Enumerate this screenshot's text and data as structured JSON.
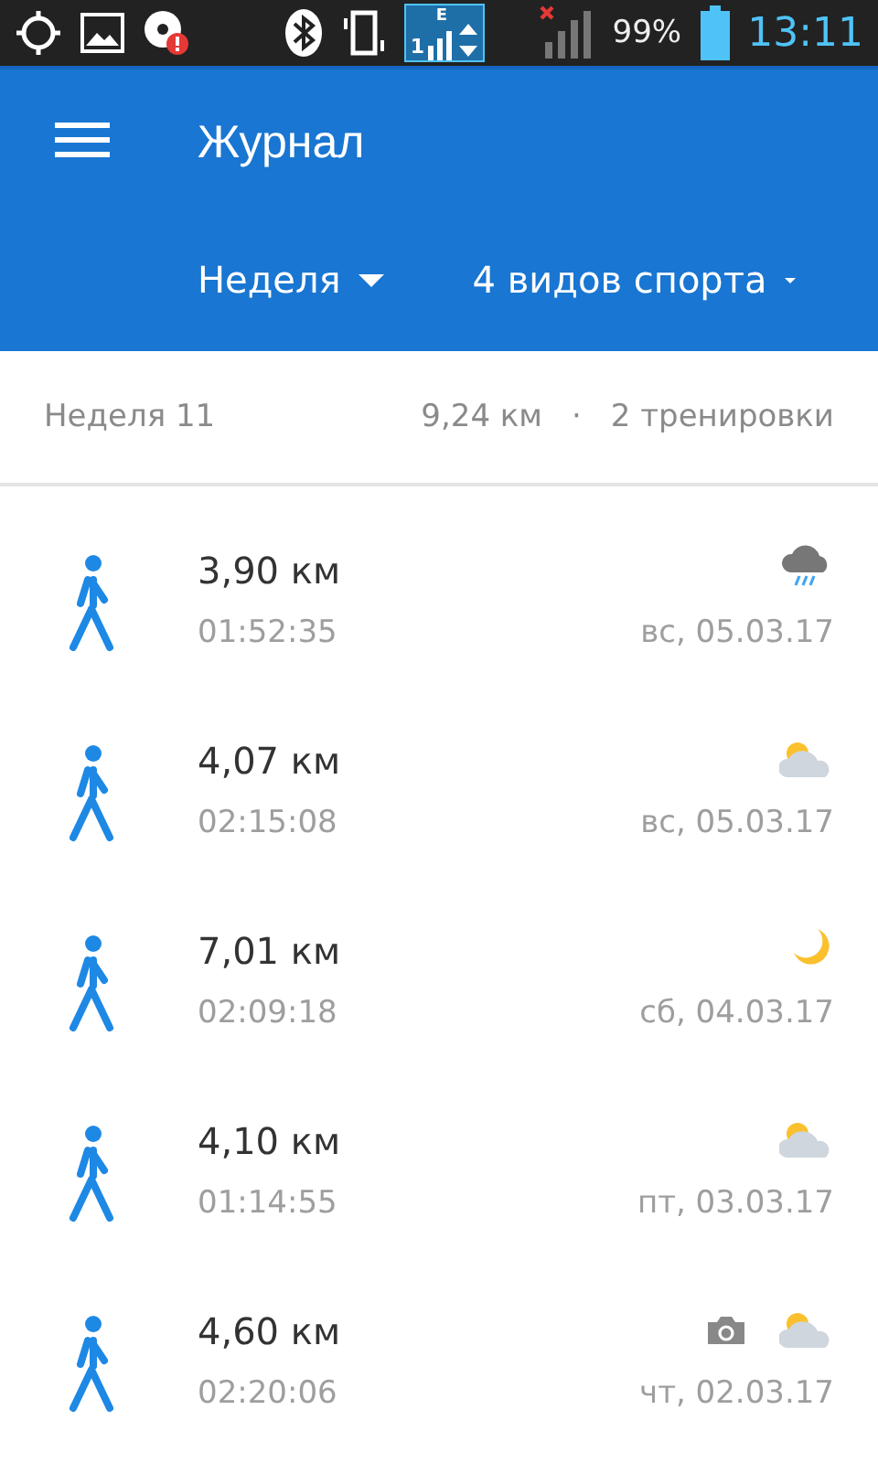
{
  "status_bar": {
    "network_type": "E",
    "sim": "1",
    "battery": "99%",
    "time": "13:11"
  },
  "app_bar": {
    "title": "Журнал"
  },
  "filters": [
    {
      "label": "Неделя"
    },
    {
      "label": "4 видов спорта"
    }
  ],
  "summary": {
    "week": "Неделя 11",
    "distance": "9,24 км",
    "separator": "·",
    "workouts": "2 тренировки"
  },
  "workouts": [
    {
      "distance": "3,90 км",
      "duration": "01:52:35",
      "date": "вс, 05.03.17",
      "weather": {
        "kind": "rain"
      },
      "photo": false
    },
    {
      "distance": "4,07 км",
      "duration": "02:15:08",
      "date": "вс, 05.03.17",
      "weather": {
        "kind": "cloudy"
      },
      "photo": false
    },
    {
      "distance": "7,01 км",
      "duration": "02:09:18",
      "date": "сб, 04.03.17",
      "weather": {
        "kind": "moon"
      },
      "photo": false
    },
    {
      "distance": "4,10 км",
      "duration": "01:14:55",
      "date": "пт, 03.03.17",
      "weather": {
        "kind": "cloudy"
      },
      "photo": false
    },
    {
      "distance": "4,60 км",
      "duration": "02:20:06",
      "date": "чт, 02.03.17",
      "weather": {
        "kind": "cloudy"
      },
      "photo": true
    }
  ]
}
